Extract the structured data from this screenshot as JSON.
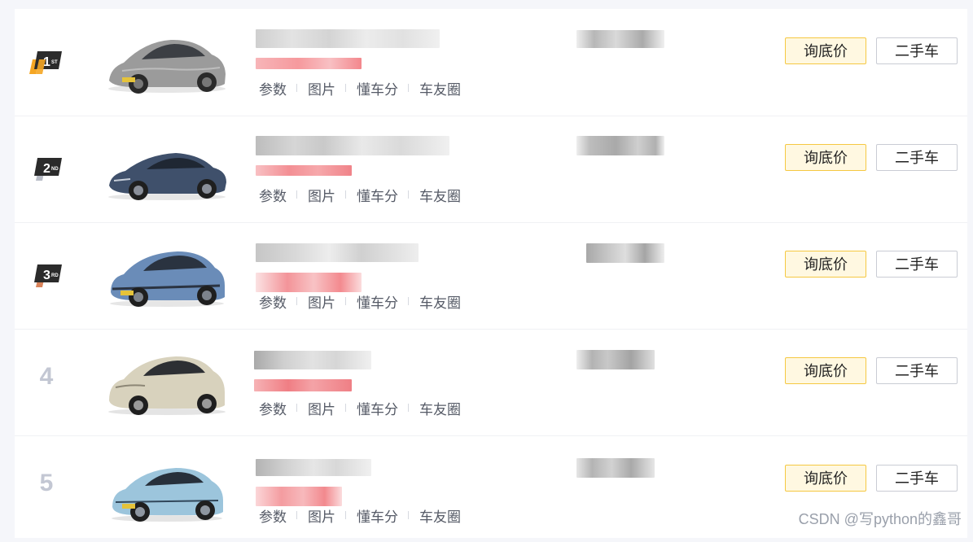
{
  "colors": {
    "rank1": "#f5a623",
    "rank2": "#b8bcc6",
    "rank3": "#d9835a",
    "rank_dark": "#2b2b2b",
    "price_button_bg": "#fff8e1",
    "price_button_border": "#f5c842"
  },
  "rows": [
    {
      "rank_num": "1",
      "rank_suffix": "ST",
      "rank_style": "badge",
      "rank_color": "#f5a623",
      "car_icon": "car-crossover-gray-icon",
      "car_color": "#9b9b9b",
      "links": [
        "参数",
        "图片",
        "懂车分",
        "车友圈"
      ],
      "price_button": "询底价",
      "used_button": "二手车"
    },
    {
      "rank_num": "2",
      "rank_suffix": "ND",
      "rank_style": "badge",
      "rank_color": "#b8bcc6",
      "car_icon": "car-sedan-blue-icon",
      "car_color": "#3f506b",
      "links": [
        "参数",
        "图片",
        "懂车分",
        "车友圈"
      ],
      "price_button": "询底价",
      "used_button": "二手车"
    },
    {
      "rank_num": "3",
      "rank_suffix": "RD",
      "rank_style": "badge",
      "rank_color": "#d9835a",
      "car_icon": "car-suv-blue-icon",
      "car_color": "#6a8cb8",
      "links": [
        "参数",
        "图片",
        "懂车分",
        "车友圈"
      ],
      "price_button": "询底价",
      "used_button": "二手车"
    },
    {
      "rank_num": "4",
      "rank_suffix": "",
      "rank_style": "plain",
      "rank_color": "#c3c7d3",
      "car_icon": "car-hatchback-champagne-icon",
      "car_color": "#d8d2bd",
      "links": [
        "参数",
        "图片",
        "懂车分",
        "车友圈"
      ],
      "price_button": "询底价",
      "used_button": "二手车"
    },
    {
      "rank_num": "5",
      "rank_suffix": "",
      "rank_style": "plain",
      "rank_color": "#c3c7d3",
      "car_icon": "car-compact-lightblue-icon",
      "car_color": "#9cc5dc",
      "links": [
        "参数",
        "图片",
        "懂车分",
        "车友圈"
      ],
      "price_button": "询底价",
      "used_button": "二手车"
    }
  ],
  "watermark": "CSDN @写python的鑫哥"
}
